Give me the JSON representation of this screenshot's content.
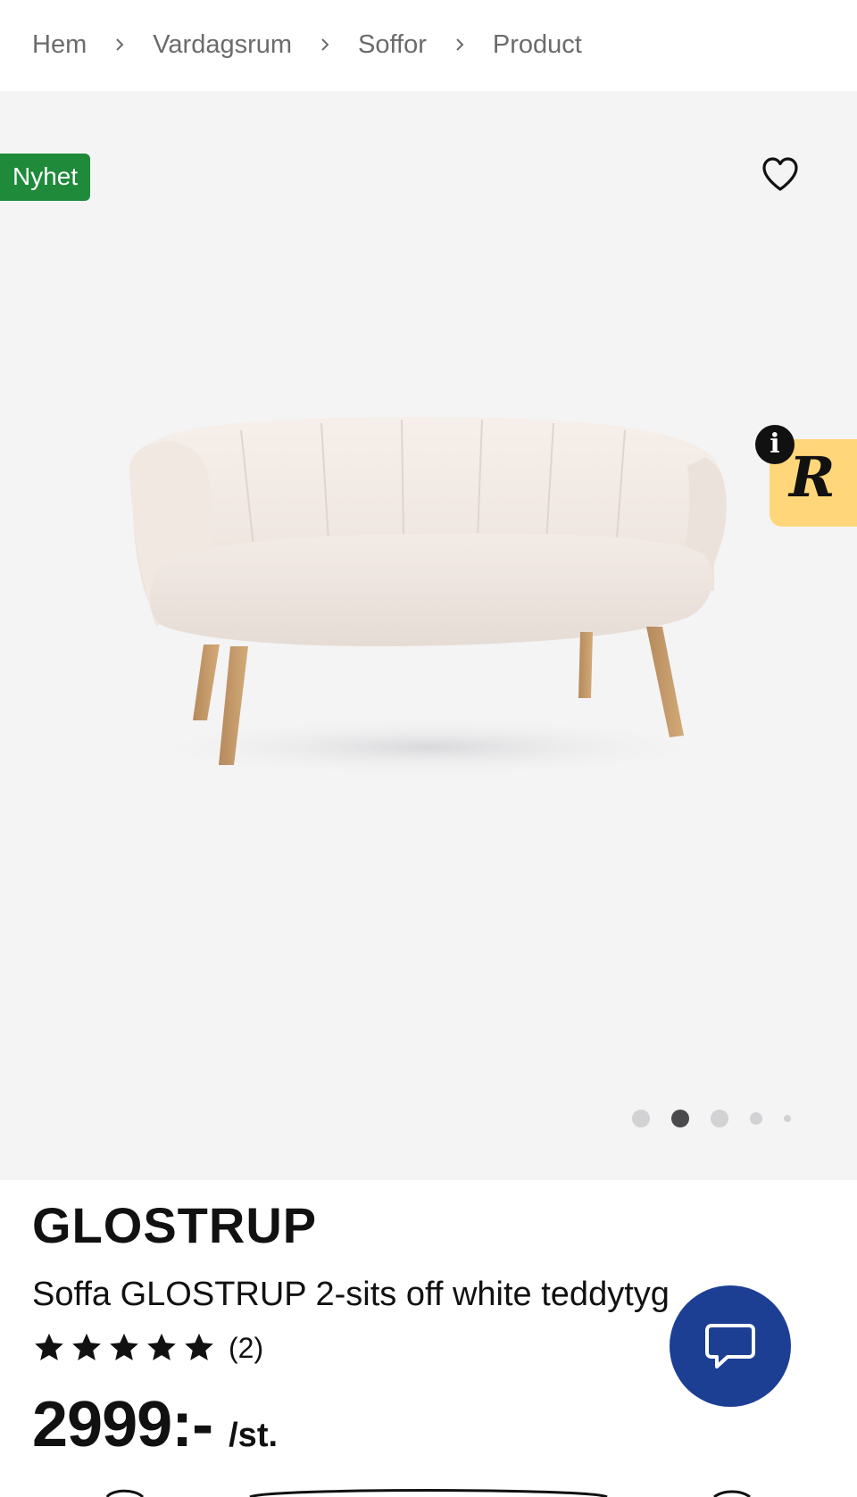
{
  "breadcrumb": {
    "items": [
      {
        "label": "Hem"
      },
      {
        "label": "Vardagsrum"
      },
      {
        "label": "Soffor"
      },
      {
        "label": "Product"
      }
    ],
    "separator_icon": "chevron-right-icon"
  },
  "gallery": {
    "badge": "Nyhet",
    "badge_color": "#1e8a3a",
    "favorite_icon": "heart-outline-icon",
    "image_subject": "cream teddy fabric 2-seat sofa with wooden legs",
    "slides_total": 5,
    "active_slide": 2,
    "widget": {
      "letter": "R",
      "info_label": "i",
      "background": "#ffd77a"
    }
  },
  "product": {
    "brand": "GLOSTRUP",
    "description": "Soffa GLOSTRUP 2-sits off white teddytyg",
    "rating": 5,
    "rating_max": 5,
    "review_count": "(2)",
    "price": "2999:-",
    "unit": "/st."
  },
  "chat": {
    "icon": "chat-bubble-icon",
    "background": "#1c3f94"
  }
}
